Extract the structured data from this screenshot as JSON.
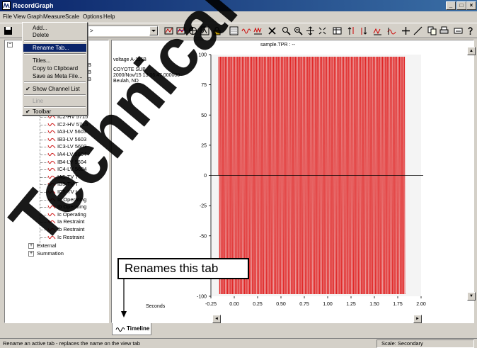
{
  "window": {
    "title": "RecordGraph",
    "min_label": "_",
    "max_label": "□",
    "close_label": "×"
  },
  "menubar": [
    {
      "label": "File",
      "name": "menu-file"
    },
    {
      "label": "View",
      "name": "menu-view"
    },
    {
      "label": "Graph",
      "name": "menu-graph"
    },
    {
      "label": "Measure",
      "name": "menu-measure"
    },
    {
      "label": "Scale",
      "name": "menu-scale"
    },
    {
      "label": "Options",
      "name": "menu-options"
    },
    {
      "label": "Help",
      "name": "menu-help"
    }
  ],
  "toolbar": {
    "combo_value": ">"
  },
  "view_menu": {
    "items": [
      {
        "label": "Add...",
        "name": "menu-add"
      },
      {
        "label": "Delete",
        "name": "menu-delete"
      },
      {
        "label": "Rename Tab...",
        "name": "menu-rename-tab"
      },
      {
        "label": "Titles...",
        "name": "menu-titles"
      },
      {
        "label": "Copy to Clipboard",
        "name": "menu-copy-clipboard"
      },
      {
        "label": "Save as Meta File...",
        "name": "menu-save-meta"
      },
      {
        "label": "Show Channel List",
        "name": "menu-show-channel-list",
        "checked": true
      },
      {
        "label": "Line",
        "name": "menu-line",
        "disabled": true
      },
      {
        "label": "Toolbar",
        "name": "menu-toolbar",
        "checked": true
      }
    ],
    "check_mark": "✔"
  },
  "tree": {
    "partial_labels": [
      "B",
      "B",
      "B"
    ],
    "channels": [
      "IC2-HV 5715",
      "IC2-HV 5715",
      "IA3-LV 5603",
      "IB3-LV 5603",
      "IC3-LV 5603",
      "IA4-LV 5604",
      "IB4-LV 5604",
      "IC4-LV 5604",
      "IA5-TV T",
      "IB5-TV T",
      "IC5-TV t",
      "Ia Operating",
      "Ib Operating",
      "Ic Operating",
      "Ia Restraint",
      "Ib Restraint",
      "Ic Restraint"
    ],
    "groups": [
      {
        "label": "External",
        "expander": "+"
      },
      {
        "label": "Summation",
        "expander": "+"
      }
    ]
  },
  "info": {
    "channel": "voltage A-115B",
    "line1": "COYOTE SUB",
    "line2": "2000/Nov/15 13:06:47.000000",
    "line3": "Beulah, ND"
  },
  "chart_title": "sample.TPR : --",
  "chart_data": {
    "type": "line",
    "title": "sample.TPR : --",
    "xlabel": "Seconds",
    "ylabel": "",
    "xlim": [
      -0.25,
      2.0
    ],
    "ylim": [
      -100,
      100
    ],
    "x_ticks": [
      "-0.25",
      "0.00",
      "0.25",
      "0.50",
      "0.75",
      "1.00",
      "1.25",
      "1.50",
      "1.75",
      "2.00"
    ],
    "y_ticks": [
      "100",
      "75",
      "50",
      "25",
      "0",
      "-25",
      "-50",
      "-75",
      "-100"
    ],
    "series": [
      {
        "frequency_hz": 60,
        "amplitude": 98,
        "x_start": -0.167,
        "x_end": 1.833,
        "color": "#e02020"
      }
    ],
    "grid": false
  },
  "tab": {
    "label": "Timeline"
  },
  "callout": {
    "text": "Renames this tab"
  },
  "status": {
    "text": "Rename an active tab - replaces the name on the view tab",
    "scale": "Scale: Secondary"
  },
  "scroll": {
    "left": "◄",
    "right": "►",
    "up": "▲",
    "down": "▼"
  },
  "watermark": {
    "text": "Technical Manual"
  }
}
